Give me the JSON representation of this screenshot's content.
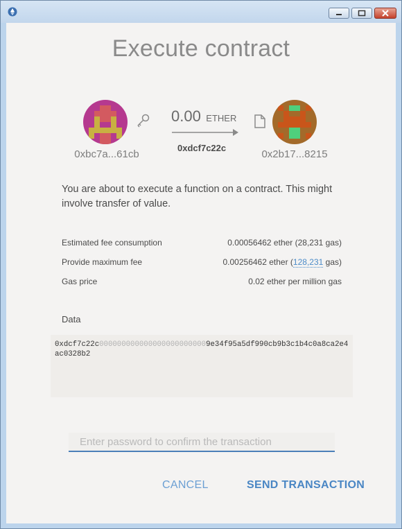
{
  "window": {
    "app_icon": "ethereum-icon",
    "controls": [
      "minimize-icon",
      "maximize-icon",
      "close-icon"
    ]
  },
  "dialog": {
    "title": "Execute contract",
    "from": {
      "address": "0xbc7a...61cb",
      "icon": "key-icon"
    },
    "to": {
      "address": "0x2b17...8215",
      "icon": "file-icon"
    },
    "amount": {
      "value": "0.00",
      "unit": "ETHER"
    },
    "contract_short": "0xdcf7c22c",
    "message": "You are about to execute a function on a contract. This might involve transfer of value.",
    "fees": {
      "estimated_label": "Estimated fee consumption",
      "estimated_value": "0.00056462 ether (28,231 gas)",
      "max_label": "Provide maximum fee",
      "max_value_prefix": "0.00256462 ether (",
      "max_value_gas": "128,231",
      "max_value_suffix": " gas)",
      "gas_price_label": "Gas price",
      "gas_price_value": "0.02 ether per million gas"
    },
    "data": {
      "label": "Data",
      "prefix": "0xdcf7c22c",
      "zeros": "000000000000000000000000",
      "rest": "9e34f95a5df990cb9b3c1b4c0a8ca2e4ac0328b2"
    },
    "password_placeholder": "Enter password to confirm the transaction",
    "buttons": {
      "cancel": "CANCEL",
      "send": "SEND TRANSACTION"
    },
    "colors": {
      "accent": "#4a86c4",
      "background": "#f4f3f2"
    }
  }
}
